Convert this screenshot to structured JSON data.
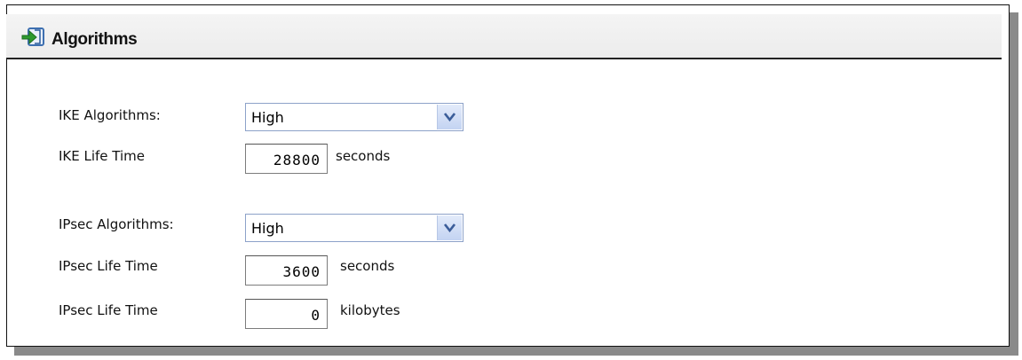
{
  "section": {
    "title": "Algorithms",
    "icon": "arrow-into-box-icon"
  },
  "ike": {
    "algorithms_label": "IKE Algorithms:",
    "algorithms_value": "High",
    "lifetime_label": "IKE Life Time",
    "lifetime_value": "28800",
    "lifetime_unit": "seconds"
  },
  "ipsec": {
    "algorithms_label": "IPsec Algorithms:",
    "algorithms_value": "High",
    "lifetime_seconds_label": "IPsec Life Time",
    "lifetime_seconds_value": "3600",
    "lifetime_seconds_unit": "seconds",
    "lifetime_kb_label": "IPsec Life Time",
    "lifetime_kb_value": "0",
    "lifetime_kb_unit": "kilobytes"
  },
  "colors": {
    "icon_green": "#2e9a2e",
    "icon_blue": "#3d6fb0",
    "dropdown_border": "#8da2c9"
  }
}
